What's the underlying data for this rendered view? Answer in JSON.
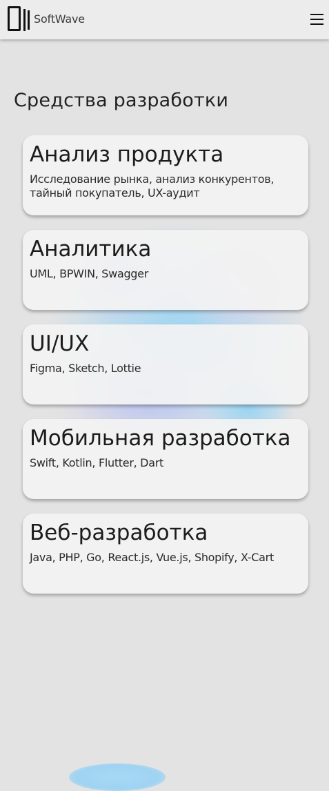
{
  "header": {
    "brand": "SoftWave",
    "logo_icon": "softwave-logo-icon",
    "menu_icon": "hamburger-menu-icon"
  },
  "main": {
    "section_title": "Средства разработки",
    "cards": [
      {
        "title": "Анализ продукта",
        "description": "Исследование рынка, анализ конкурентов, тайный покупатель, UX-аудит"
      },
      {
        "title": "Аналитика",
        "description": "UML, BPWIN, Swagger"
      },
      {
        "title": "UI/UX",
        "description": "Figma, Sketch, Lottie"
      },
      {
        "title": "Мобильная разработка",
        "description": "Swift, Kotlin, Flutter, Dart"
      },
      {
        "title": "Веб-разработка",
        "description": "Java, PHP, Go, React.js, Vue.js, Shopify, X-Cart"
      }
    ]
  },
  "colors": {
    "page_background": "#e3e3e3",
    "header_background": "#ececec",
    "card_background": "#f3f3f3",
    "splash_blue": "#9fd3f2",
    "splash_purple": "#c7c0f0"
  }
}
